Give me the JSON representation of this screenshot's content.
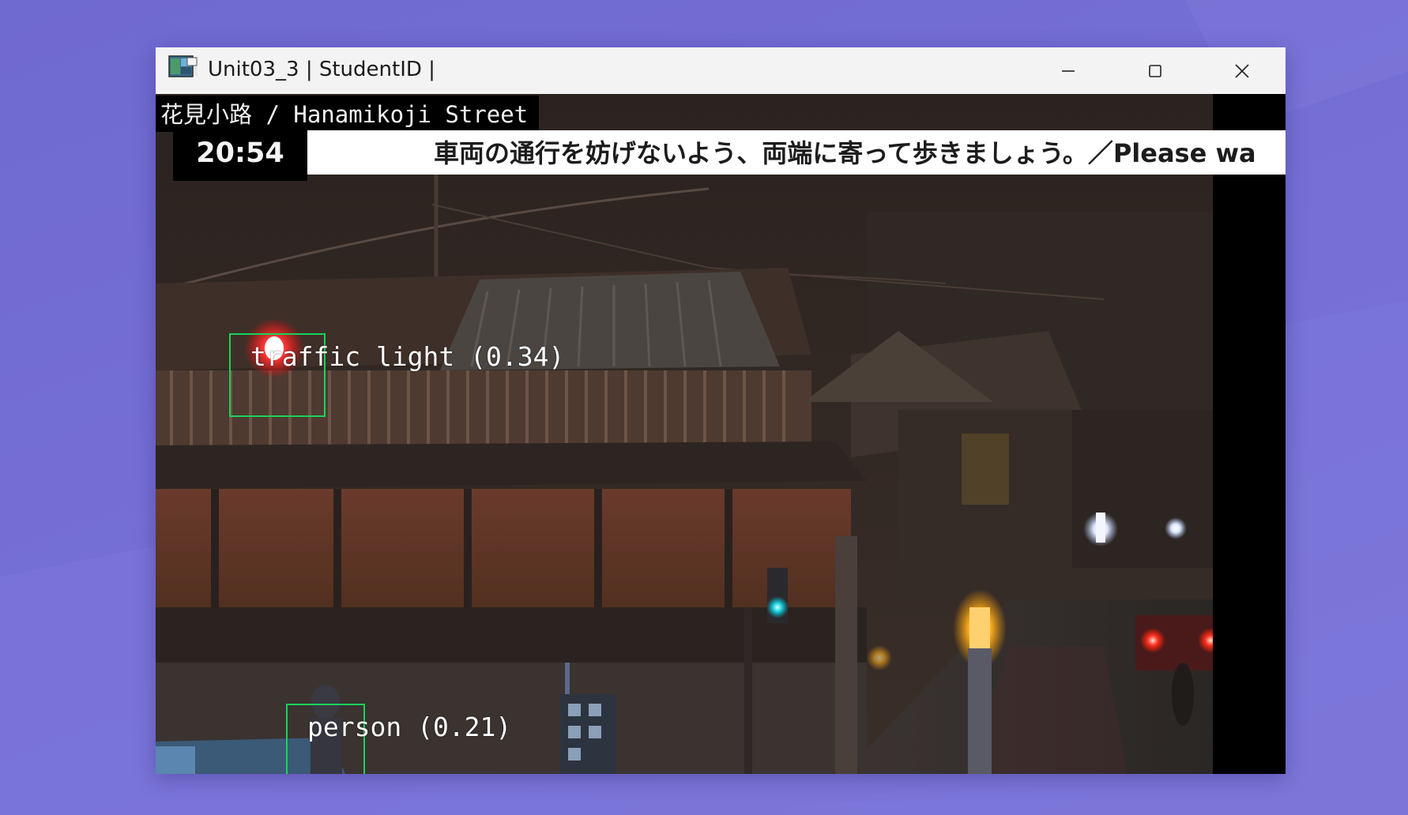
{
  "window": {
    "title": "Unit03_3 | StudentID |",
    "controls": {
      "minimize": "minimize-icon",
      "maximize": "maximize-icon",
      "close": "close-icon"
    }
  },
  "video": {
    "street_label": "花見小路 / Hanamikoji Street",
    "clock": "20:54",
    "ticker": "車両の通行を妨げないよう、両端に寄って歩きましょう。／Please wa",
    "detections": [
      {
        "label": "traffic light (0.34)",
        "class": "traffic light",
        "confidence": 0.34
      },
      {
        "label": "person (0.21)",
        "class": "person",
        "confidence": 0.21
      }
    ]
  },
  "colors": {
    "background": "#7470d4",
    "titlebar": "#f3f3f3",
    "detection_box": "#19d35a"
  }
}
